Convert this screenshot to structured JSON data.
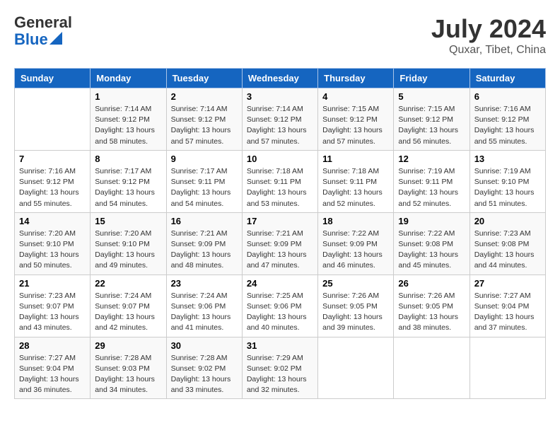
{
  "logo": {
    "general": "General",
    "blue": "Blue"
  },
  "header": {
    "month_year": "July 2024",
    "location": "Quxar, Tibet, China"
  },
  "days_of_week": [
    "Sunday",
    "Monday",
    "Tuesday",
    "Wednesday",
    "Thursday",
    "Friday",
    "Saturday"
  ],
  "weeks": [
    [
      {
        "day": "",
        "info": ""
      },
      {
        "day": "1",
        "info": "Sunrise: 7:14 AM\nSunset: 9:12 PM\nDaylight: 13 hours\nand 58 minutes."
      },
      {
        "day": "2",
        "info": "Sunrise: 7:14 AM\nSunset: 9:12 PM\nDaylight: 13 hours\nand 57 minutes."
      },
      {
        "day": "3",
        "info": "Sunrise: 7:14 AM\nSunset: 9:12 PM\nDaylight: 13 hours\nand 57 minutes."
      },
      {
        "day": "4",
        "info": "Sunrise: 7:15 AM\nSunset: 9:12 PM\nDaylight: 13 hours\nand 57 minutes."
      },
      {
        "day": "5",
        "info": "Sunrise: 7:15 AM\nSunset: 9:12 PM\nDaylight: 13 hours\nand 56 minutes."
      },
      {
        "day": "6",
        "info": "Sunrise: 7:16 AM\nSunset: 9:12 PM\nDaylight: 13 hours\nand 55 minutes."
      }
    ],
    [
      {
        "day": "7",
        "info": "Sunrise: 7:16 AM\nSunset: 9:12 PM\nDaylight: 13 hours\nand 55 minutes."
      },
      {
        "day": "8",
        "info": "Sunrise: 7:17 AM\nSunset: 9:12 PM\nDaylight: 13 hours\nand 54 minutes."
      },
      {
        "day": "9",
        "info": "Sunrise: 7:17 AM\nSunset: 9:11 PM\nDaylight: 13 hours\nand 54 minutes."
      },
      {
        "day": "10",
        "info": "Sunrise: 7:18 AM\nSunset: 9:11 PM\nDaylight: 13 hours\nand 53 minutes."
      },
      {
        "day": "11",
        "info": "Sunrise: 7:18 AM\nSunset: 9:11 PM\nDaylight: 13 hours\nand 52 minutes."
      },
      {
        "day": "12",
        "info": "Sunrise: 7:19 AM\nSunset: 9:11 PM\nDaylight: 13 hours\nand 52 minutes."
      },
      {
        "day": "13",
        "info": "Sunrise: 7:19 AM\nSunset: 9:10 PM\nDaylight: 13 hours\nand 51 minutes."
      }
    ],
    [
      {
        "day": "14",
        "info": "Sunrise: 7:20 AM\nSunset: 9:10 PM\nDaylight: 13 hours\nand 50 minutes."
      },
      {
        "day": "15",
        "info": "Sunrise: 7:20 AM\nSunset: 9:10 PM\nDaylight: 13 hours\nand 49 minutes."
      },
      {
        "day": "16",
        "info": "Sunrise: 7:21 AM\nSunset: 9:09 PM\nDaylight: 13 hours\nand 48 minutes."
      },
      {
        "day": "17",
        "info": "Sunrise: 7:21 AM\nSunset: 9:09 PM\nDaylight: 13 hours\nand 47 minutes."
      },
      {
        "day": "18",
        "info": "Sunrise: 7:22 AM\nSunset: 9:09 PM\nDaylight: 13 hours\nand 46 minutes."
      },
      {
        "day": "19",
        "info": "Sunrise: 7:22 AM\nSunset: 9:08 PM\nDaylight: 13 hours\nand 45 minutes."
      },
      {
        "day": "20",
        "info": "Sunrise: 7:23 AM\nSunset: 9:08 PM\nDaylight: 13 hours\nand 44 minutes."
      }
    ],
    [
      {
        "day": "21",
        "info": "Sunrise: 7:23 AM\nSunset: 9:07 PM\nDaylight: 13 hours\nand 43 minutes."
      },
      {
        "day": "22",
        "info": "Sunrise: 7:24 AM\nSunset: 9:07 PM\nDaylight: 13 hours\nand 42 minutes."
      },
      {
        "day": "23",
        "info": "Sunrise: 7:24 AM\nSunset: 9:06 PM\nDaylight: 13 hours\nand 41 minutes."
      },
      {
        "day": "24",
        "info": "Sunrise: 7:25 AM\nSunset: 9:06 PM\nDaylight: 13 hours\nand 40 minutes."
      },
      {
        "day": "25",
        "info": "Sunrise: 7:26 AM\nSunset: 9:05 PM\nDaylight: 13 hours\nand 39 minutes."
      },
      {
        "day": "26",
        "info": "Sunrise: 7:26 AM\nSunset: 9:05 PM\nDaylight: 13 hours\nand 38 minutes."
      },
      {
        "day": "27",
        "info": "Sunrise: 7:27 AM\nSunset: 9:04 PM\nDaylight: 13 hours\nand 37 minutes."
      }
    ],
    [
      {
        "day": "28",
        "info": "Sunrise: 7:27 AM\nSunset: 9:04 PM\nDaylight: 13 hours\nand 36 minutes."
      },
      {
        "day": "29",
        "info": "Sunrise: 7:28 AM\nSunset: 9:03 PM\nDaylight: 13 hours\nand 34 minutes."
      },
      {
        "day": "30",
        "info": "Sunrise: 7:28 AM\nSunset: 9:02 PM\nDaylight: 13 hours\nand 33 minutes."
      },
      {
        "day": "31",
        "info": "Sunrise: 7:29 AM\nSunset: 9:02 PM\nDaylight: 13 hours\nand 32 minutes."
      },
      {
        "day": "",
        "info": ""
      },
      {
        "day": "",
        "info": ""
      },
      {
        "day": "",
        "info": ""
      }
    ]
  ]
}
